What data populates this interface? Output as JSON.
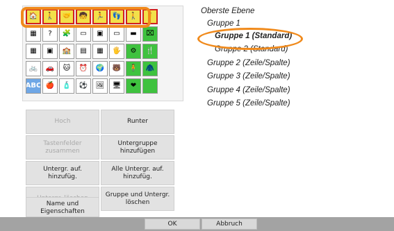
{
  "symbol_grid": {
    "rows": [
      [
        "🏠",
        "🚶",
        "🤝",
        "🧒",
        "🏃",
        "👣",
        "🚶",
        "🧍"
      ],
      [
        "▦",
        "?",
        "🧩",
        "▭",
        "▣",
        "▭",
        "▬",
        "⌧"
      ],
      [
        "▦",
        "▣",
        "🏫",
        "▤",
        "▦",
        "🖐",
        "⚙",
        "🍴"
      ],
      [
        "🚲",
        "🚗",
        "🐱",
        "⏰",
        "🌍",
        "🐻",
        "🧍",
        "🧥"
      ],
      [
        "ABC",
        "🍎",
        "🧴",
        "⚽",
        "🖼",
        "🖥",
        "❤",
        ""
      ]
    ]
  },
  "buttons": {
    "hoch": "Hoch",
    "runter": "Runter",
    "tastenfeld_zusammen": "Tastenfelder zusammen",
    "untergruppe_hinzufuegen": "Untergruppe hinzufügen",
    "untergr_auf_hinzufuegen": "Untergr. auf. hinzufüg.",
    "alle_untergr_auf_hinzufuegen": "Alle Untergr. auf. hinzufüg.",
    "untergr_loeschen": "Untergr. löschen",
    "gruppe_und_untergr_loeschen": "Gruppe und Untergr. löschen",
    "name_und_eigenschaften": "Name und Eigenschaften"
  },
  "tree": {
    "root": "Oberste Ebene",
    "gruppe1": "Gruppe 1",
    "gruppe1_standard": "Gruppe 1 (Standard)",
    "gruppe2_standard": "Gruppe 2 (Standard)",
    "gruppe2_zeile": "Gruppe 2 (Zeile/Spalte)",
    "gruppe3_zeile": "Gruppe 3 (Zeile/Spalte)",
    "gruppe4_zeile": "Gruppe 4 (Zeile/Spalte)",
    "gruppe5_zeile": "Gruppe 5 (Zeile/Spalte)"
  },
  "dialog": {
    "ok": "OK",
    "abbruch": "Abbruch"
  },
  "colors": {
    "highlight": "#f08a1c",
    "bottom_bar": "#a3a3a3",
    "selected_row": "#f2e04a",
    "green_key": "#3fc23f"
  }
}
